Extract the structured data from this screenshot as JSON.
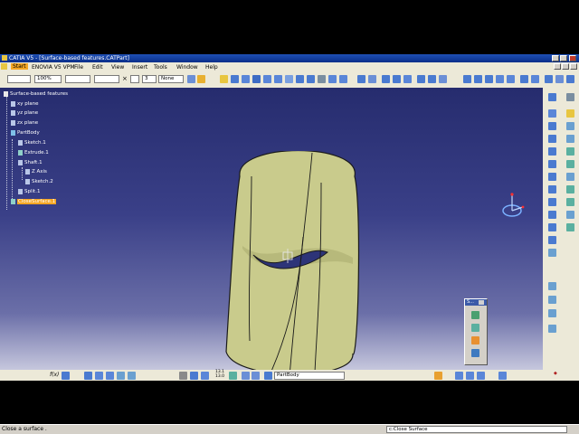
{
  "window": {
    "title": "CATIA V5 - [Surface-based features.CATPart]"
  },
  "menu": [
    {
      "label": "Start"
    },
    {
      "label": "ENOVIA V5 VPM"
    },
    {
      "label": "File"
    },
    {
      "label": "Edit"
    },
    {
      "label": "View"
    },
    {
      "label": "Insert"
    },
    {
      "label": "Tools"
    },
    {
      "label": "Window"
    },
    {
      "label": "Help"
    }
  ],
  "toolbar": {
    "zoom_value": "100%",
    "layer_value": "None",
    "point_value": "3"
  },
  "tree": {
    "root": "Surface-based features",
    "xy": "xy plane",
    "yz": "yz plane",
    "zx": "zx plane",
    "partbody": "PartBody",
    "sketch1": "Sketch.1",
    "extrude1": "Extrude.1",
    "shaft1": "Shaft.1",
    "zaxis": "Z Axis",
    "sketch2": "Sketch.2",
    "split1": "Split.1",
    "close": "CloseSurface.1"
  },
  "floating_toolbar": {
    "title": "S..."
  },
  "bottom": {
    "body_select": "PartBody",
    "coord_top": "13.1",
    "coord_bottom": "13.0",
    "fx_label": "f(x)"
  },
  "status": {
    "message": "Close a surface .",
    "command": "c:Close Surface"
  },
  "colors": {
    "surface": "#c9cb8c",
    "surface_dark": "#a6a86a",
    "highlight": "#f5a623",
    "background_top": "#262c6e"
  }
}
